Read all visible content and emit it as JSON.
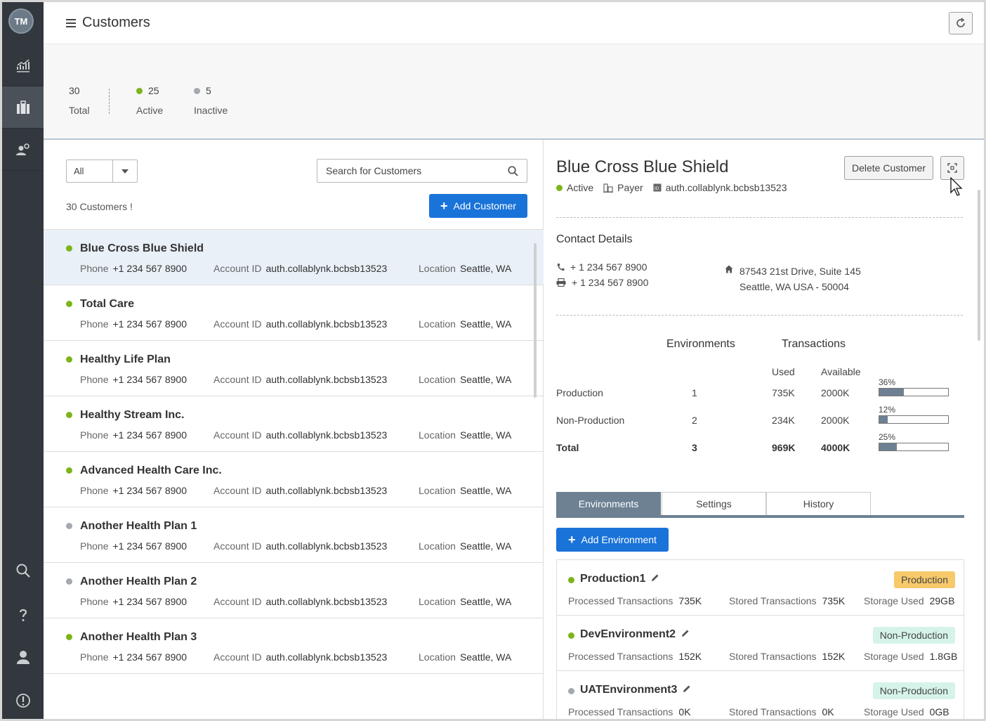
{
  "sidebar": {
    "avatar_initials": "TM"
  },
  "header": {
    "title": "Customers"
  },
  "stats": {
    "total": {
      "value": "30",
      "label": "Total"
    },
    "active": {
      "value": "25",
      "label": "Active"
    },
    "inactive": {
      "value": "5",
      "label": "Inactive"
    }
  },
  "list": {
    "filter_value": "All",
    "search_placeholder": "Search for Customers",
    "count_text": "30 Customers !",
    "add_button": "Add Customer",
    "labels": {
      "phone": "Phone",
      "account": "Account ID",
      "location": "Location"
    },
    "customers": [
      {
        "name": "Blue Cross Blue Shield",
        "status": "active",
        "phone": "+1 234 567 8900",
        "account": "auth.collablynk.bcbsb13523",
        "location": "Seattle, WA"
      },
      {
        "name": "Total Care",
        "status": "active",
        "phone": "+1 234 567 8900",
        "account": "auth.collablynk.bcbsb13523",
        "location": "Seattle, WA"
      },
      {
        "name": "Healthy Life Plan",
        "status": "active",
        "phone": "+1 234 567 8900",
        "account": "auth.collablynk.bcbsb13523",
        "location": "Seattle, WA"
      },
      {
        "name": "Healthy Stream Inc.",
        "status": "active",
        "phone": "+1 234 567 8900",
        "account": "auth.collablynk.bcbsb13523",
        "location": "Seattle, WA"
      },
      {
        "name": "Advanced Health Care Inc.",
        "status": "active",
        "phone": "+1 234 567 8900",
        "account": "auth.collablynk.bcbsb13523",
        "location": "Seattle, WA"
      },
      {
        "name": "Another Health Plan 1",
        "status": "inactive",
        "phone": "+1 234 567 8900",
        "account": "auth.collablynk.bcbsb13523",
        "location": "Seattle, WA"
      },
      {
        "name": "Another Health Plan 2",
        "status": "inactive",
        "phone": "+1 234 567 8900",
        "account": "auth.collablynk.bcbsb13523",
        "location": "Seattle, WA"
      },
      {
        "name": "Another Health Plan 3",
        "status": "active",
        "phone": "+1 234 567 8900",
        "account": "auth.collablynk.bcbsb13523",
        "location": "Seattle, WA"
      }
    ]
  },
  "detail": {
    "name": "Blue Cross Blue Shield",
    "status": "Active",
    "type": "Payer",
    "account": "auth.collablynk.bcbsb13523",
    "delete_button": "Delete Customer",
    "contact_title": "Contact Details",
    "phone": "+ 1 234 567 8900",
    "fax": "+ 1 234 567 8900",
    "address_line1": "87543 21st Drive, Suite 145",
    "address_line2": "Seattle, WA USA - 50004",
    "usage": {
      "environments_header": "Environments",
      "transactions_header": "Transactions",
      "used_header": "Used",
      "available_header": "Available",
      "rows": [
        {
          "label": "Production",
          "envs": "1",
          "used": "735K",
          "available": "2000K",
          "pct_label": "36%",
          "pct": 36
        },
        {
          "label": "Non-Production",
          "envs": "2",
          "used": "234K",
          "available": "2000K",
          "pct_label": "12%",
          "pct": 12
        },
        {
          "label": "Total",
          "envs": "3",
          "used": "969K",
          "available": "4000K",
          "pct_label": "25%",
          "pct": 25
        }
      ]
    },
    "tabs": [
      "Environments",
      "Settings",
      "History"
    ],
    "add_env_button": "Add Environment",
    "env_labels": {
      "processed": "Processed Transactions",
      "stored": "Stored Transactions",
      "storage": "Storage Used"
    },
    "environments": [
      {
        "name": "Production1",
        "status": "active",
        "badge": "Production",
        "processed": "735K",
        "stored": "735K",
        "storage": "29GB"
      },
      {
        "name": "DevEnvironment2",
        "status": "active",
        "badge": "Non-Production",
        "processed": "152K",
        "stored": "152K",
        "storage": "1.8GB"
      },
      {
        "name": "UATEnvironment3",
        "status": "inactive",
        "badge": "Non-Production",
        "processed": "0K",
        "stored": "0K",
        "storage": "0GB"
      }
    ]
  },
  "colors": {
    "accent": "#1a73d9",
    "active": "#7cb518",
    "inactive": "#a3a9ae",
    "sidebar": "#33383f",
    "tab_active": "#6d8193"
  }
}
